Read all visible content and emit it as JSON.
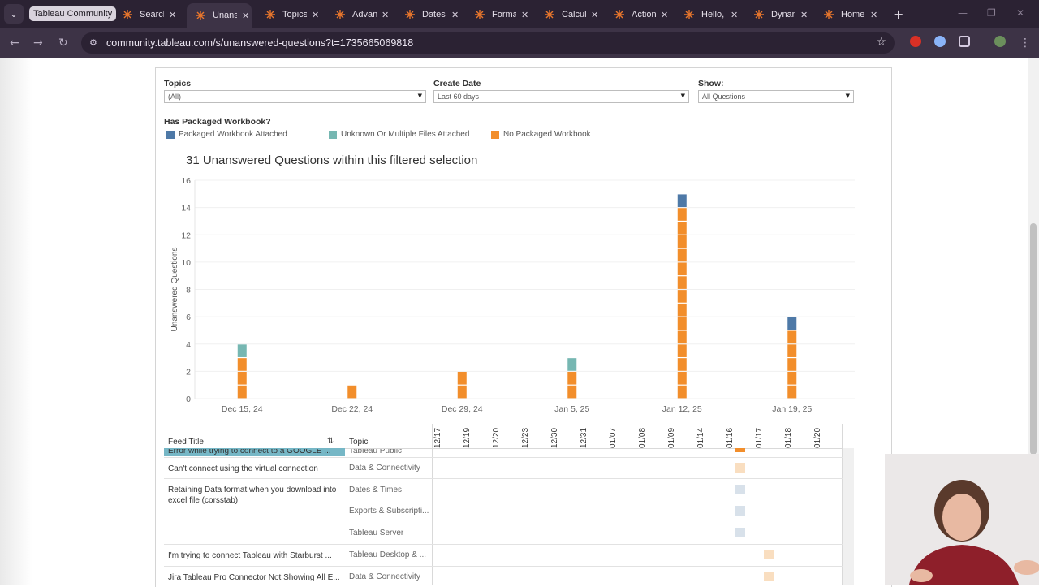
{
  "browser": {
    "tabs": [
      {
        "label": "Tableau Community",
        "active": false
      },
      {
        "label": "Search",
        "active": false
      },
      {
        "label": "Unans",
        "active": true
      },
      {
        "label": "Topics",
        "active": false
      },
      {
        "label": "Advan",
        "active": false
      },
      {
        "label": "Dates",
        "active": false
      },
      {
        "label": "Forma",
        "active": false
      },
      {
        "label": "Calcul",
        "active": false
      },
      {
        "label": "Action",
        "active": false
      },
      {
        "label": "Hello,",
        "active": false
      },
      {
        "label": "Dynan",
        "active": false
      },
      {
        "label": "Home",
        "active": false
      }
    ],
    "url": "community.tableau.com/s/unanswered-questions?t=1735665069818"
  },
  "filters": {
    "topics": {
      "label": "Topics",
      "value": "(All)"
    },
    "create_date": {
      "label": "Create Date",
      "value": "Last 60 days"
    },
    "show": {
      "label": "Show:",
      "value": "All Questions"
    }
  },
  "legend": {
    "title": "Has Packaged Workbook?",
    "items": [
      {
        "label": "Packaged Workbook Attached",
        "color": "#4e79a7"
      },
      {
        "label": "Unknown Or Multiple Files Attached",
        "color": "#76b7b2"
      },
      {
        "label": "No Packaged Workbook",
        "color": "#f28e2b"
      }
    ]
  },
  "chart_title": "31 Unanswered Questions within this filtered selection",
  "chart_data": {
    "type": "bar",
    "stacked": true,
    "title": "31 Unanswered Questions within this filtered selection",
    "ylabel": "Unanswered Questions",
    "xlabel": "",
    "ylim": [
      0,
      16
    ],
    "y_ticks": [
      0,
      2,
      4,
      6,
      8,
      10,
      12,
      14,
      16
    ],
    "x_tick_labels": [
      "Dec 15, 24",
      "Dec 22, 24",
      "Dec 29, 24",
      "Jan 5, 25",
      "Jan 12, 25",
      "Jan 19, 25"
    ],
    "categories": [
      "Dec 15, 24",
      "Dec 22, 24",
      "Dec 29, 24",
      "Jan 5, 25",
      "Jan 12, 25",
      "Jan 19, 25"
    ],
    "series": [
      {
        "name": "No Packaged Workbook",
        "color": "#f28e2b",
        "values": [
          3,
          1,
          2,
          2,
          14,
          5
        ]
      },
      {
        "name": "Unknown Or Multiple Files Attached",
        "color": "#76b7b2",
        "values": [
          1,
          0,
          0,
          1,
          0,
          0
        ]
      },
      {
        "name": "Packaged Workbook Attached",
        "color": "#4e79a7",
        "values": [
          0,
          0,
          0,
          0,
          1,
          1
        ]
      }
    ],
    "grid": true
  },
  "table": {
    "headers": {
      "feed_title": "Feed Title",
      "topic": "Topic"
    },
    "date_columns": [
      "12/17",
      "12/19",
      "12/20",
      "12/23",
      "12/30",
      "12/31",
      "01/07",
      "01/08",
      "01/09",
      "01/14",
      "01/16",
      "01/17",
      "01/18",
      "01/20"
    ],
    "rows": [
      {
        "title": "Error while trying to connect to a GOOGLE ...",
        "topic": "Tableau Public"
      },
      {
        "title": "Can't connect using the virtual connection",
        "topic": "Data & Connectivity"
      },
      {
        "title": "Retaining Data format when you download into excel file (corsstab).",
        "topic": "Dates & Times"
      },
      {
        "title": "",
        "topic": "Exports & Subscripti..."
      },
      {
        "title": "",
        "topic": "Tableau Server"
      },
      {
        "title": "I'm trying to connect Tableau with Starburst ...",
        "topic": "Tableau Desktop & ..."
      },
      {
        "title": "Jira Tableau Pro Connector Not Showing All E...",
        "topic": "Data & Connectivity"
      }
    ]
  }
}
